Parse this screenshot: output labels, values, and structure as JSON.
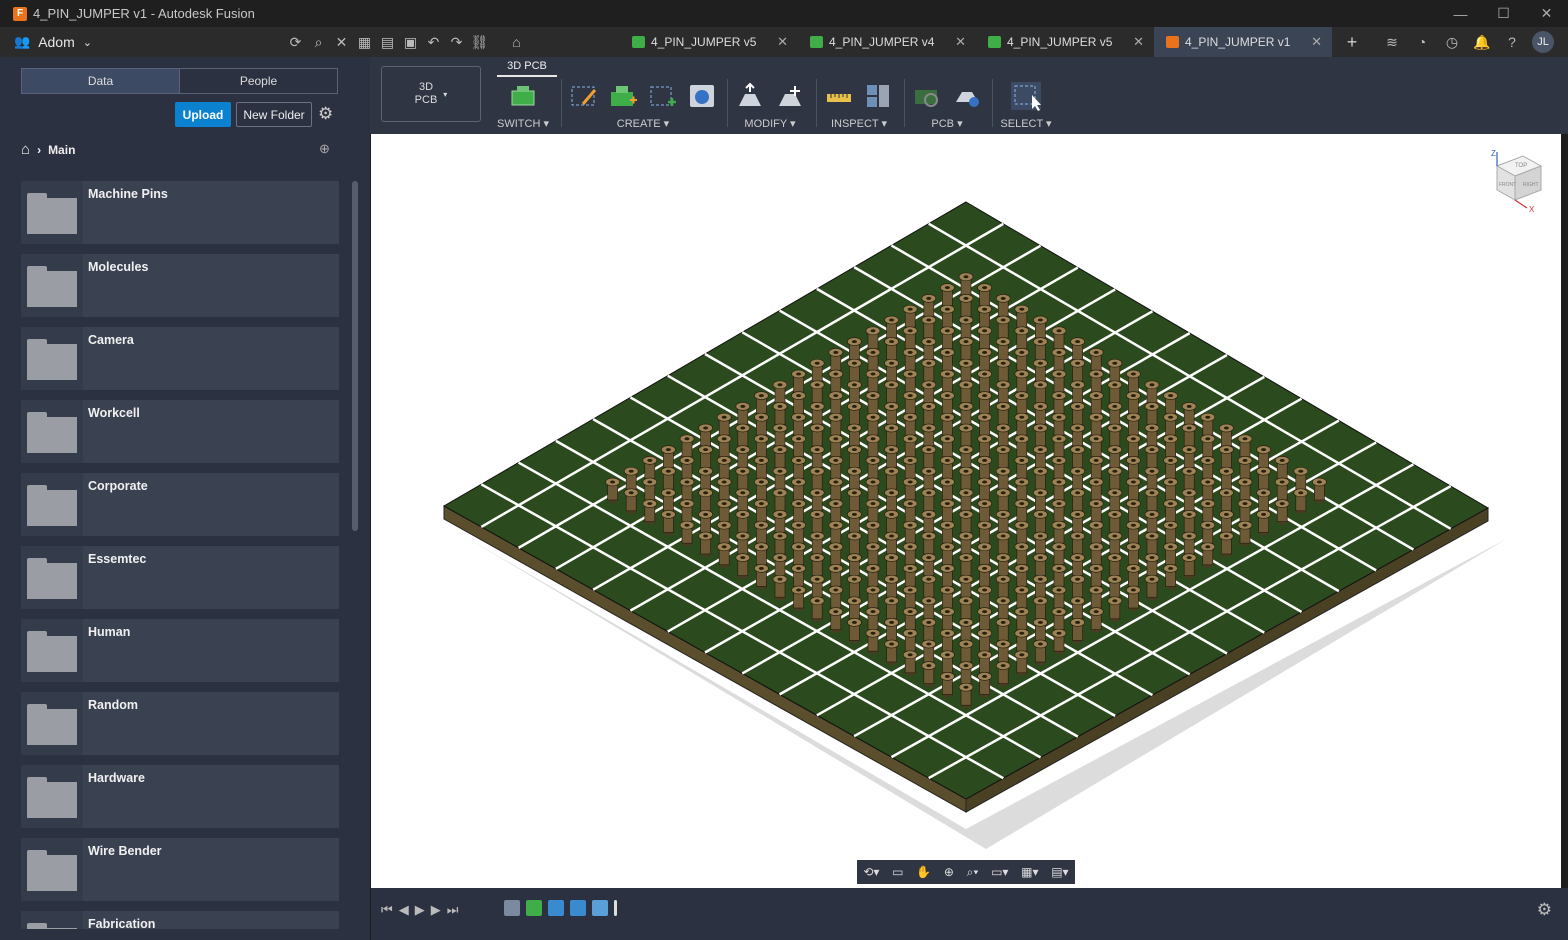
{
  "window": {
    "title": "4_PIN_JUMPER v1 - Autodesk Fusion",
    "logo_letter": "F"
  },
  "topbar": {
    "team_name": "Adom",
    "tabs": [
      {
        "label": "4_PIN_JUMPER v5",
        "icon": "pcb-icon",
        "color": "#3fae49"
      },
      {
        "label": "4_PIN_JUMPER v4",
        "icon": "schematic-icon",
        "color": "#3fae49"
      },
      {
        "label": "4_PIN_JUMPER v5",
        "icon": "pcb-icon",
        "color": "#3fae49"
      },
      {
        "label": "4_PIN_JUMPER v1",
        "icon": "3d-pcb-icon",
        "color": "#e8731c",
        "active": true
      }
    ],
    "avatar_initials": "JL"
  },
  "sidebar": {
    "tabs": [
      "Data",
      "People"
    ],
    "upload_label": "Upload",
    "new_folder_label": "New Folder",
    "breadcrumb": "Main",
    "folders": [
      "Machine Pins",
      "Molecules",
      "Camera",
      "Workcell",
      "Corporate",
      "Essemtec",
      "Human",
      "Random",
      "Hardware",
      "Wire Bender",
      "Fabrication"
    ]
  },
  "toolbar": {
    "workspace_label_line1": "3D",
    "workspace_label_line2": "PCB",
    "active_tab": "3D PCB",
    "groups": [
      "SWITCH ▾",
      "CREATE ▾",
      "MODIFY ▾",
      "INSPECT ▾",
      "PCB ▾",
      "SELECT ▾"
    ]
  },
  "viewcube": {
    "top": "TOP",
    "front": "FRONT",
    "right": "RIGHT",
    "axis_z": "Z",
    "axis_x": "X"
  },
  "colors": {
    "board_green": "#2b4a1d",
    "board_edge": "#5a4e2c",
    "grid_line": "#ffffff",
    "pin": "#6e5a36",
    "accent": "#0a82d0"
  }
}
